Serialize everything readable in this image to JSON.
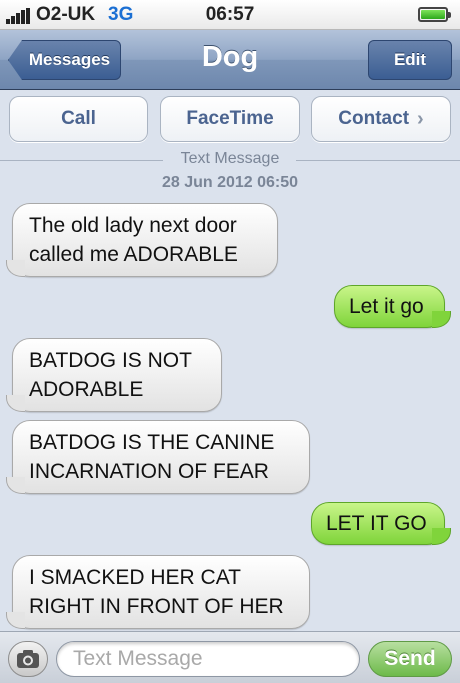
{
  "status_bar": {
    "carrier": "O2-UK",
    "network": "3G",
    "time": "06:57",
    "battery_level": 1.0
  },
  "nav": {
    "back_label": "Messages",
    "title": "Dog",
    "edit_label": "Edit"
  },
  "actions": {
    "call": "Call",
    "facetime": "FaceTime",
    "contact": "Contact"
  },
  "thread": {
    "separator": "Text Message",
    "date": "28 Jun 2012 06:50",
    "messages": [
      {
        "direction": "incoming",
        "lines": [
          "The old lady next door",
          "called me ADORABLE"
        ]
      },
      {
        "direction": "outgoing",
        "lines": [
          "Let it go"
        ]
      },
      {
        "direction": "incoming",
        "lines": [
          "BATDOG IS NOT",
          "ADORABLE"
        ]
      },
      {
        "direction": "incoming",
        "lines": [
          "BATDOG IS THE CANINE",
          "INCARNATION OF FEAR"
        ]
      },
      {
        "direction": "outgoing",
        "lines": [
          "LET IT GO"
        ]
      },
      {
        "direction": "incoming",
        "lines": [
          "I SMACKED HER CAT",
          "RIGHT IN FRONT OF HER"
        ]
      }
    ]
  },
  "composer": {
    "placeholder": "Text Message",
    "send_label": "Send"
  },
  "colors": {
    "nav_blue": "#6d87ad",
    "outgoing_green": "#7fd43a",
    "incoming_gray": "#e2e2e2",
    "background": "#dbe2ed"
  }
}
